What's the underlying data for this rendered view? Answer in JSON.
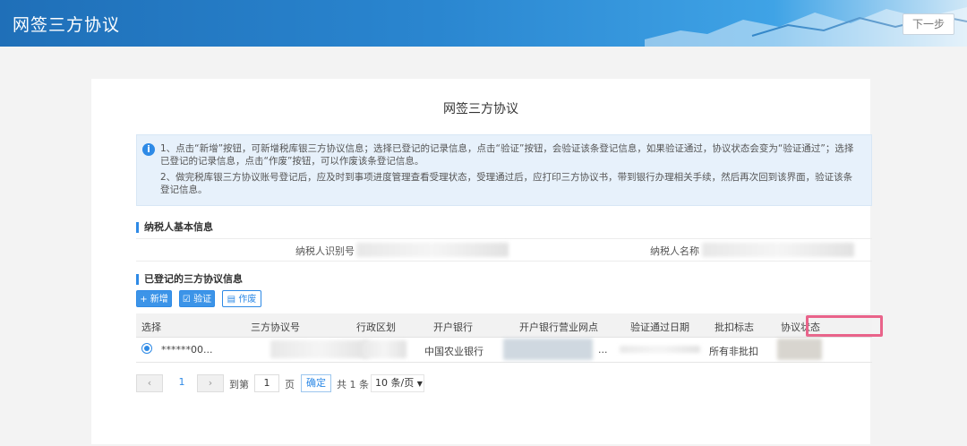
{
  "header": {
    "app_title": "网签三方协议",
    "next_button": "下一步"
  },
  "page": {
    "title": "网签三方协议",
    "notice": {
      "line1": "1、点击“新增”按钮，可新增税库银三方协议信息；选择已登记的记录信息，点击“验证”按钮，会验证该条登记信息，如果验证通过，协议状态会变为“验证通过”；选择已登记的记录信息，点击“作废”按钮，可以作废该条登记信息。",
      "line2": "2、做完税库银三方协议账号登记后，应及时到事项进度管理查看受理状态，受理通过后，应打印三方协议书，带到银行办理相关手续，然后再次回到该界面，验证该条登记信息。"
    }
  },
  "taxpayer": {
    "section_title": "纳税人基本信息",
    "id_label": "纳税人识别号",
    "name_label": "纳税人名称"
  },
  "agreements": {
    "section_title": "已登记的三方协议信息",
    "buttons": {
      "add": "新增",
      "verify": "验证",
      "void": "作废"
    },
    "columns": [
      "选择",
      "三方协议号",
      "行政区划",
      "开户银行",
      "开户银行营业网点",
      "验证通过日期",
      "批扣标志",
      "协议状态"
    ],
    "rows": [
      {
        "account": "******00...",
        "bank": "中国农业银行",
        "branch_suffix": "...",
        "batch_flag": "所有非批扣"
      }
    ]
  },
  "pagination": {
    "current_page": "1",
    "goto_label": "到第",
    "goto_value": "1",
    "page_suffix": "页",
    "confirm": "确定",
    "total": "共 1 条",
    "page_size": "10 条/页"
  }
}
